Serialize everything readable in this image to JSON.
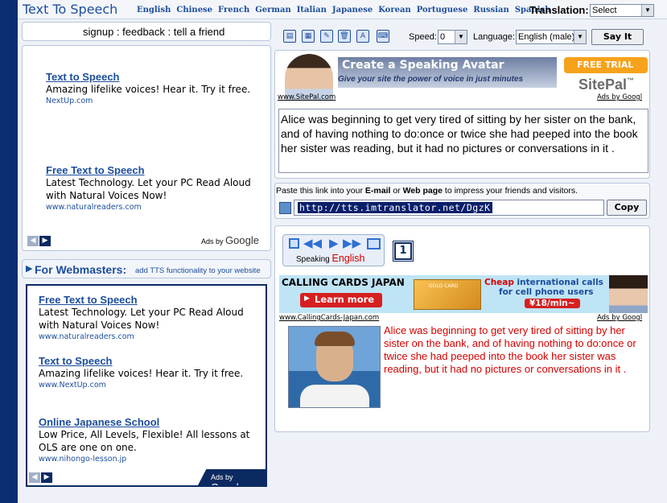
{
  "header": {
    "title": "Text To Speech",
    "languages": [
      "English",
      "Chinese",
      "French",
      "German",
      "Italian",
      "Japanese",
      "Korean",
      "Portuguese",
      "Russian",
      "Spanish"
    ],
    "translation_label": "Translation:",
    "translation_value": "Select"
  },
  "left": {
    "links_bar": "signup : feedback : tell a friend",
    "ads_top": [
      {
        "title": "Text to Speech",
        "text": "Amazing lifelike voices! Hear it. Try it free.",
        "url": "NextUp.com"
      },
      {
        "title": "Free Text to Speech",
        "text": "Latest Technology. Let your PC Read Aloud with Natural Voices Now!",
        "url": "www.naturalreaders.com"
      }
    ],
    "ads_by_prefix": "Ads by",
    "ads_by_brand": "Google",
    "webmasters_title": "For Webmasters:",
    "webmasters_sub": "add TTS functionality to your website",
    "ads_bottom": [
      {
        "title": "Free Text to Speech",
        "text": "Latest Technology. Let your PC Read Aloud with Natural Voices Now!",
        "url": "www.naturalreaders.com"
      },
      {
        "title": "Text to Speech",
        "text": "Amazing lifelike voices! Hear it. Try it free.",
        "url": "www.NextUp.com"
      },
      {
        "title": "Online Japanese School",
        "text": "Low Price, All Levels, Flexible! All lessons at OLS are one on one.",
        "url": "www.nihongo-lesson.jp"
      }
    ]
  },
  "toolbar": {
    "speed_label": "Speed:",
    "speed_value": "0",
    "language_label": "Language:",
    "language_value": "English (male)",
    "say_it": "Say It"
  },
  "sitepal": {
    "headline": "Create a Speaking Avatar",
    "sub": "Give your site the power of voice in just minutes",
    "free_trial": "FREE TRIAL",
    "brand": "SitePal",
    "tm": "™",
    "url": "www.SitePal.com",
    "ads_by": "Ads by Googl"
  },
  "input_text": "Alice was beginning to get very tired of sitting by her sister on the bank, and of having nothing to do:once or twice she had peeped into the book her sister was reading, but it had no pictures or conversations in it .",
  "link": {
    "hint_pre": "Paste this link into your ",
    "hint_email": "E-mail",
    "hint_or": " or ",
    "hint_web": "Web page",
    "hint_post": " to impress your friends and visitors.",
    "url": "http://tts.imtranslator.net/DgzK",
    "copy": "Copy"
  },
  "player": {
    "speaking_label": "Speaking",
    "speaking_lang": "English",
    "page_number": "1"
  },
  "calling_banner": {
    "title": "CALLING CARDS JAPAN",
    "learn_more": "Learn more",
    "card_label": "GOLD CARD",
    "cheap_1": "Cheap",
    "cheap_2": " international calls",
    "cheap_3": "for cell phone users",
    "price": "¥18/min~",
    "url": "www.CallingCards-Japan.com",
    "ads_by": "Ads by Googl"
  },
  "output_text": "Alice was beginning to get very tired of sitting by her sister on the bank, and of having nothing to do:once or twice she had peeped into the book her sister was reading, but it had no pictures or conversations in it .",
  "colors": {
    "accent": "#1c4d9c",
    "frame": "#0b2d72",
    "speak_red": "#d60000"
  }
}
